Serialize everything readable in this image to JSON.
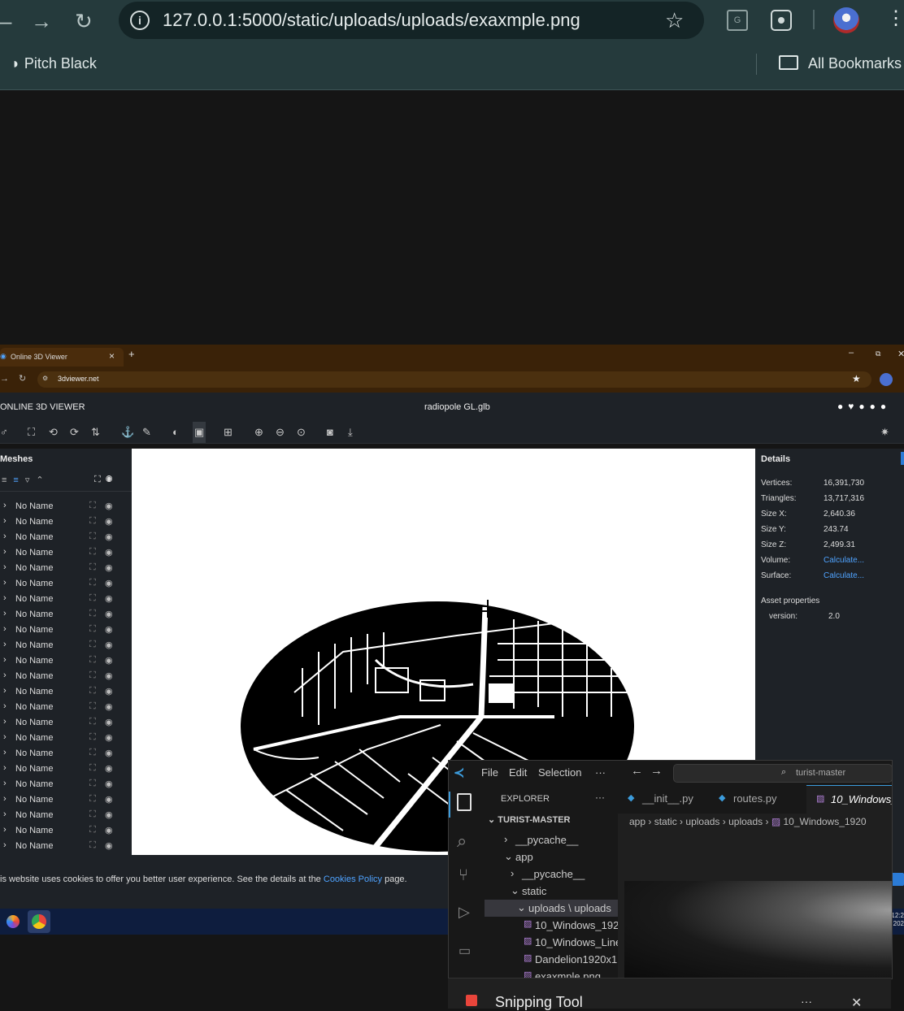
{
  "browser": {
    "url": "127.0.0.1:5000/static/uploads/uploads/exaxmple.png",
    "bookmark_left": "Pitch Black",
    "bookmark_right": "All Bookmarks"
  },
  "inner_browser": {
    "tab_title": "Online 3D Viewer",
    "tab_close": "×",
    "new_tab": "+",
    "address": "3dviewer.net"
  },
  "viewer": {
    "app_title": "ONLINE 3D VIEWER",
    "file_name": "radiopole GL.glb",
    "meshes_title": "Meshes",
    "mesh_label": "No Name",
    "mesh_count": 23,
    "details": {
      "title": "Details",
      "rows": [
        {
          "label": "Vertices:",
          "value": "16,391,730"
        },
        {
          "label": "Triangles:",
          "value": "13,717,316"
        },
        {
          "label": "Size X:",
          "value": "2,640.36"
        },
        {
          "label": "Size Y:",
          "value": "243.74"
        },
        {
          "label": "Size Z:",
          "value": "2,499.31"
        },
        {
          "label": "Volume:",
          "value": "Calculate..."
        },
        {
          "label": "Surface:",
          "value": "Calculate..."
        }
      ],
      "asset_title": "Asset properties",
      "asset_label": "version:",
      "asset_value": "2.0"
    },
    "cookie_text": "is website uses cookies to offer you better user experience. See the details at the",
    "cookie_link": "Cookies Policy",
    "cookie_end": "page."
  },
  "vscode": {
    "menu": [
      "File",
      "Edit",
      "Selection",
      "···"
    ],
    "search": "turist-master",
    "explorer_title": "EXPLORER",
    "explorer_more": "···",
    "root": "TURIST-MASTER",
    "tree": [
      {
        "label": "__pycache__",
        "indent": 1,
        "kind": "closed"
      },
      {
        "label": "app",
        "indent": 1,
        "kind": "open"
      },
      {
        "label": "__pycache__",
        "indent": 2,
        "kind": "closed"
      },
      {
        "label": "static",
        "indent": 2,
        "kind": "open"
      },
      {
        "label": "uploads \\ uploads",
        "indent": 3,
        "kind": "open"
      },
      {
        "label": "10_Windows_192...",
        "indent": 4,
        "kind": "file"
      },
      {
        "label": "10_Windows_Line...",
        "indent": 4,
        "kind": "file"
      },
      {
        "label": "Dandelion1920x1...",
        "indent": 4,
        "kind": "file"
      },
      {
        "label": "exaxmple.png",
        "indent": 4,
        "kind": "file"
      }
    ],
    "tabs": [
      "__init__.py",
      "routes.py",
      "10_Windows_"
    ],
    "breadcrumb": [
      "app",
      "static",
      "uploads",
      "uploads",
      "10_Windows_1920"
    ]
  },
  "snipping": {
    "title": "Snipping Tool",
    "more": "···",
    "close": "✕"
  },
  "clock": {
    "time": "12:2",
    "date": "202"
  }
}
